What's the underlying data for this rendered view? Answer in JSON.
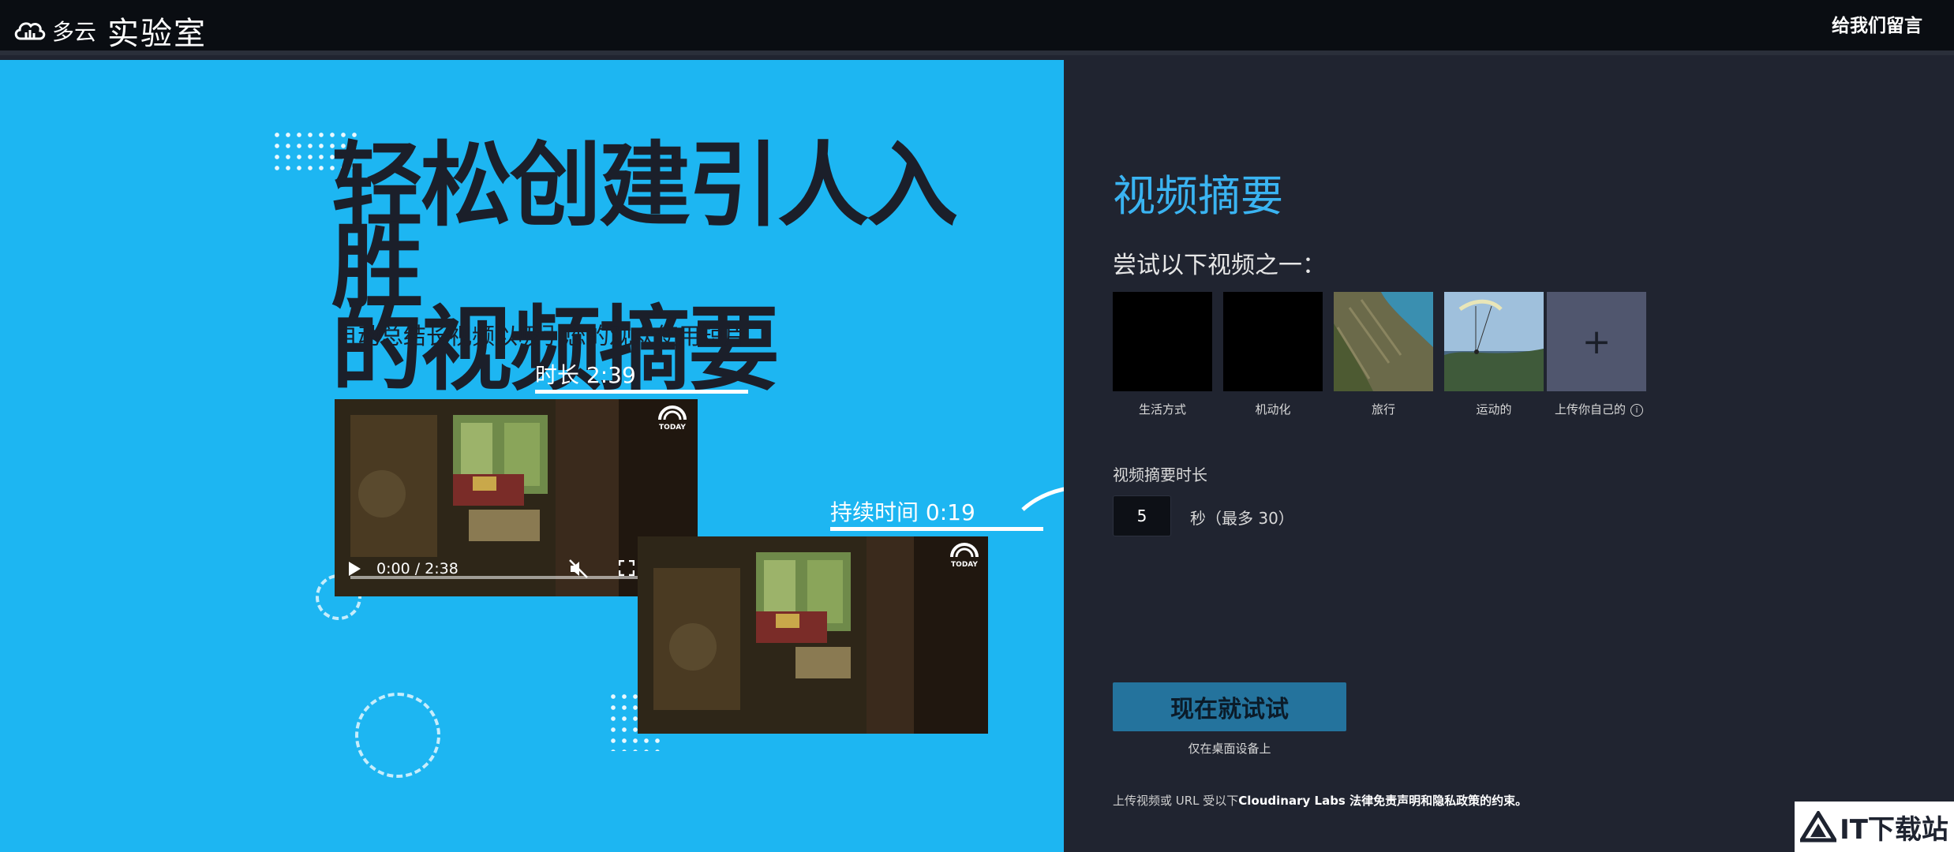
{
  "header": {
    "brand_small": "多云",
    "brand_big": "实验室",
    "feedback_link": "给我们留言"
  },
  "hero": {
    "headline_line1": "轻松创建引人入胜",
    "headline_line2": "的视频摘要",
    "subheading": "自动总结长视频以吸引您的观众使用短片",
    "original_duration_label": "时长 2:39",
    "summary_duration_label": "持续时间 0:19",
    "player": {
      "time": "0:00 / 2:38",
      "progress": 0
    }
  },
  "panel": {
    "title": "视频摘要",
    "prompt": "尝试以下视频之一：",
    "samples": [
      {
        "label": "生活方式"
      },
      {
        "label": "机动化"
      },
      {
        "label": "旅行"
      },
      {
        "label": "运动的"
      }
    ],
    "upload_label": "上传你自己的",
    "upload_symbol": "+",
    "length_label": "视频摘要时长",
    "length_value": "5",
    "length_suffix": "秒（最多 30）",
    "try_button": "现在就试试",
    "desktop_note": "仅在桌面设备上",
    "legal_prefix": "上传视频或 URL 受以下",
    "legal_bold": "Cloudinary Labs 法律免责声明和隐私政策的约束。"
  },
  "watermark": {
    "text": "IT下载站"
  },
  "colors": {
    "hero_background": "#1db6f2",
    "panel_background": "#202430",
    "accent_title": "#3ab4f2",
    "button": "#24739d",
    "topbar": "#0a0d12"
  }
}
